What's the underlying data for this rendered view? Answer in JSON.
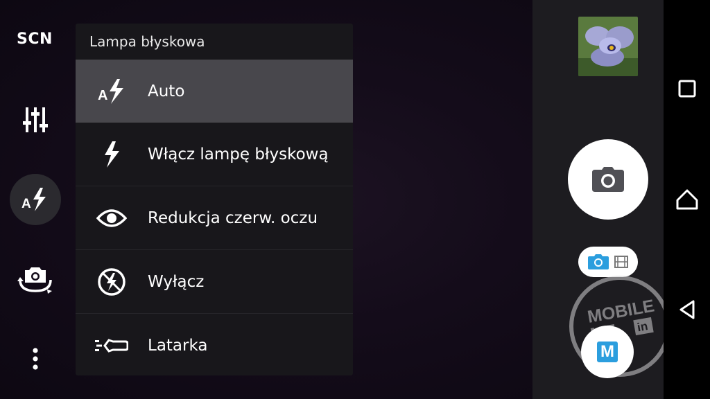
{
  "left_rail": {
    "scene_label": "SCN",
    "items": [
      {
        "name": "scene-mode",
        "icon": "scn-text"
      },
      {
        "name": "settings",
        "icon": "sliders-icon"
      },
      {
        "name": "flash",
        "icon": "flash-auto-icon"
      },
      {
        "name": "switch-camera",
        "icon": "camera-switch-icon"
      },
      {
        "name": "more",
        "icon": "more-vertical-icon"
      }
    ]
  },
  "flash_menu": {
    "title": "Lampa błyskowa",
    "selected_index": 0,
    "items": [
      {
        "label": "Auto",
        "icon": "flash-auto-icon"
      },
      {
        "label": "Włącz lampę błyskową",
        "icon": "flash-on-icon"
      },
      {
        "label": "Redukcja czerw. oczu",
        "icon": "red-eye-icon"
      },
      {
        "label": "Wyłącz",
        "icon": "flash-off-icon"
      },
      {
        "label": "Latarka",
        "icon": "torch-icon"
      }
    ]
  },
  "right_panel": {
    "thumbnail": "last-photo-thumbnail",
    "shutter": "camera-icon",
    "mode_toggle": {
      "active": "photo",
      "options": [
        "photo",
        "video"
      ]
    },
    "watermark": {
      "line1": "MOBILE",
      "line2": "ME",
      "badge": "in"
    },
    "mode_button": "M"
  },
  "nav_bar": {
    "items": [
      "recents-square-icon",
      "home-icon",
      "back-icon"
    ]
  },
  "colors": {
    "accent": "#2b9ede",
    "menu_bg": "#18171b",
    "selected_bg": "#48474c",
    "panel_bg": "#1d1c20"
  }
}
